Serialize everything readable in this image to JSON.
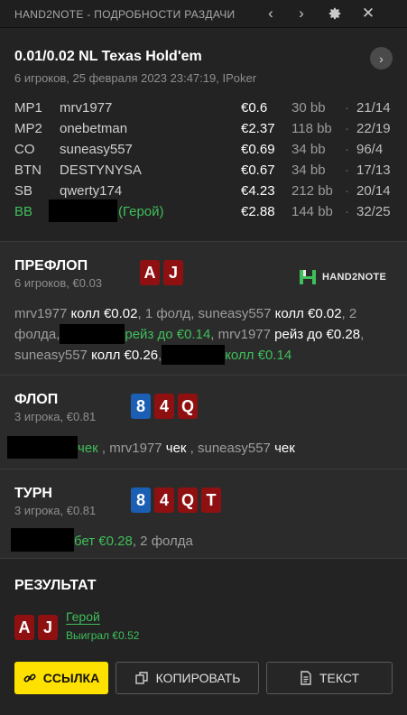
{
  "window": {
    "title": "HAND2NOTE - ПОДРОБНОСТИ РАЗДАЧИ",
    "prev_icon": "chevron-left-icon",
    "next_icon": "chevron-right-icon",
    "settings_icon": "gear-icon",
    "close_icon": "close-icon"
  },
  "hand": {
    "title": "0.01/0.02 NL Texas Hold'em",
    "subtitle": "6 игроков, 25 февраля 2023 23:47:19, IPoker",
    "players": [
      {
        "pos": "MP1",
        "name": "mrv1977",
        "stack": "€0.6",
        "bb": "30 bb",
        "sep": "·",
        "stat": "21/14"
      },
      {
        "pos": "MP2",
        "name": "onebetman",
        "stack": "€2.37",
        "bb": "118 bb",
        "sep": "·",
        "stat": "22/19"
      },
      {
        "pos": "CO",
        "name": "suneasy557",
        "stack": "€0.69",
        "bb": "34 bb",
        "sep": "·",
        "stat": "96/4"
      },
      {
        "pos": "BTN",
        "name": "DESTYNYSA",
        "stack": "€0.67",
        "bb": "34 bb",
        "sep": "·",
        "stat": "17/13"
      },
      {
        "pos": "SB",
        "name": "qwerty174",
        "stack": "€4.23",
        "bb": "212 bb",
        "sep": "·",
        "stat": "20/14"
      },
      {
        "pos": "BB",
        "name": "(Герой)",
        "stack": "€2.88",
        "bb": "144 bb",
        "sep": "·",
        "stat": "32/25"
      }
    ]
  },
  "preflop": {
    "title": "ПРЕФЛОП",
    "subtitle": "6 игроков, €0.03",
    "cards": [
      {
        "rank": "A",
        "color": "#8f1010"
      },
      {
        "rank": "J",
        "color": "#8f1010"
      }
    ],
    "logo_text": "HAND2NOTE",
    "line1_a": "mrv1977 ",
    "line1_b": "колл €0.02",
    "line1_c": ", 1 фолд, suneasy557 ",
    "line1_d": "колл €0.02",
    "line1_e": ", 2",
    "line2_a": "фолда,",
    "line2_b": "рейз до €0.14",
    "line2_c": ", mrv1977 ",
    "line2_d": "рейз до €0.28",
    "line2_e": ",",
    "line3_a": "suneasy557 ",
    "line3_b": "колл €0.26",
    "line3_c": ",",
    "line3_d": "колл €0.14"
  },
  "flop": {
    "title": "ФЛОП",
    "subtitle": "3 игрока, €0.81",
    "cards": [
      {
        "rank": "8",
        "color": "#1a5fb4"
      },
      {
        "rank": "4",
        "color": "#8f1010"
      },
      {
        "rank": "Q",
        "color": "#8f1010"
      }
    ],
    "line_a": "чек",
    "line_b": " , mrv1977 ",
    "line_c": "чек",
    "line_d": " , suneasy557 ",
    "line_e": "чек"
  },
  "turn": {
    "title": "ТУРН",
    "subtitle": "3 игрока, €0.81",
    "cards": [
      {
        "rank": "8",
        "color": "#1a5fb4"
      },
      {
        "rank": "4",
        "color": "#8f1010"
      },
      {
        "rank": "Q",
        "color": "#8f1010"
      },
      {
        "rank": "T",
        "color": "#8f1010"
      }
    ],
    "line_a": "бет €0.28",
    "line_b": ", 2 фолда"
  },
  "result": {
    "title": "РЕЗУЛЬТАТ",
    "cards": [
      {
        "rank": "A",
        "color": "#8f1010"
      },
      {
        "rank": "J",
        "color": "#8f1010"
      }
    ],
    "hero_label": "Герой",
    "won_label": "Выиграл €0.52"
  },
  "buttons": {
    "link_label": "ССЫЛКА",
    "link_icon": "link-icon",
    "copy_label": "КОПИРОВАТЬ",
    "copy_icon": "copy-icon",
    "text_label": "ТЕКСТ",
    "text_icon": "document-icon"
  },
  "colors": {
    "accent_green": "#3fbf5a",
    "card_red": "#8f1010",
    "card_blue": "#1a5fb4",
    "button_yellow": "#ffe100"
  }
}
